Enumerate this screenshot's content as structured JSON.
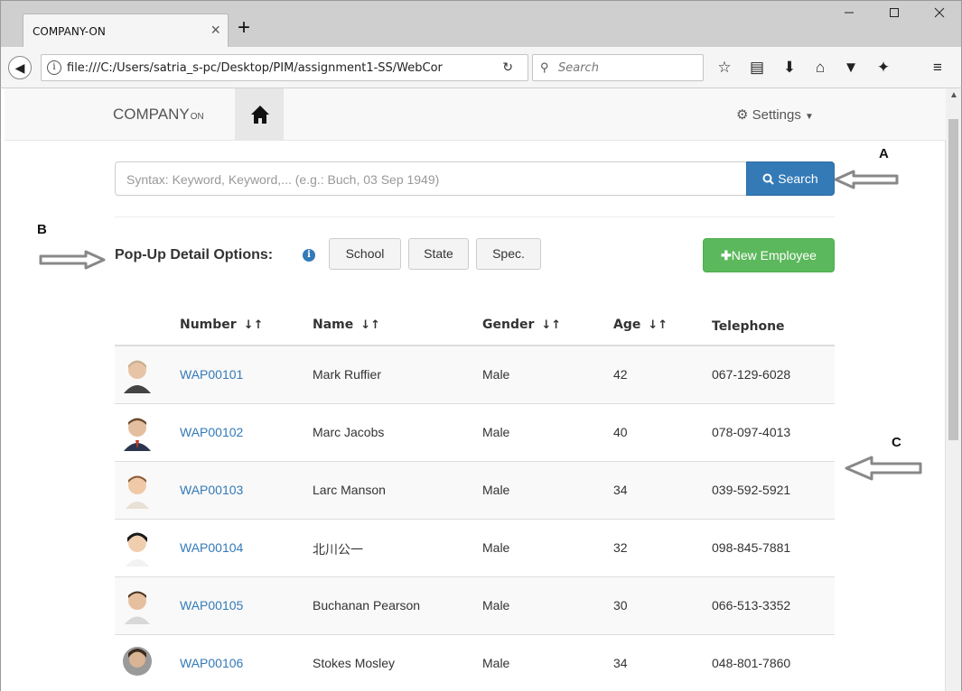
{
  "browser": {
    "tab_title": "COMPANY-ON",
    "tab_close": "×",
    "new_tab": "+",
    "url": "file:///C:/Users/satria_s-pc/Desktop/PIM/assignment1-SS/WebCor",
    "search_placeholder": "Search",
    "window_controls": [
      "minimize-icon",
      "maximize-icon",
      "close-icon"
    ],
    "toolbar_icons": [
      "star-icon",
      "reading-list-icon",
      "download-icon",
      "home-icon",
      "pocket-icon",
      "extension-icon",
      "menu-icon"
    ]
  },
  "app_nav": {
    "brand": "COMPANY",
    "brand_suffix": "ON",
    "settings_label": "Settings"
  },
  "search": {
    "placeholder": "Syntax: Keyword, Keyword,... (e.g.: Buch, 03 Sep 1949)",
    "button_label": "Search"
  },
  "popup_options": {
    "label": "Pop-Up Detail Options:",
    "buttons": [
      "School",
      "State",
      "Spec."
    ]
  },
  "new_employee_label": "New Employee",
  "table": {
    "columns": [
      "Number",
      "Name",
      "Gender",
      "Age",
      "Telephone"
    ],
    "rows": [
      {
        "number": "WAP00101",
        "name": "Mark Ruffier",
        "gender": "Male",
        "age": "42",
        "telephone": "067-129-6028"
      },
      {
        "number": "WAP00102",
        "name": "Marc Jacobs",
        "gender": "Male",
        "age": "40",
        "telephone": "078-097-4013"
      },
      {
        "number": "WAP00103",
        "name": "Larc Manson",
        "gender": "Male",
        "age": "34",
        "telephone": "039-592-5921"
      },
      {
        "number": "WAP00104",
        "name": "北川公一",
        "gender": "Male",
        "age": "32",
        "telephone": "098-845-7881"
      },
      {
        "number": "WAP00105",
        "name": "Buchanan Pearson",
        "gender": "Male",
        "age": "30",
        "telephone": "066-513-3352"
      },
      {
        "number": "WAP00106",
        "name": "Stokes Mosley",
        "gender": "Male",
        "age": "34",
        "telephone": "048-801-7860"
      }
    ]
  },
  "annotations": {
    "a": "A",
    "b": "B",
    "c": "C"
  },
  "colors": {
    "primary": "#337ab7",
    "success": "#5cb85c",
    "arrow": "#888888"
  }
}
